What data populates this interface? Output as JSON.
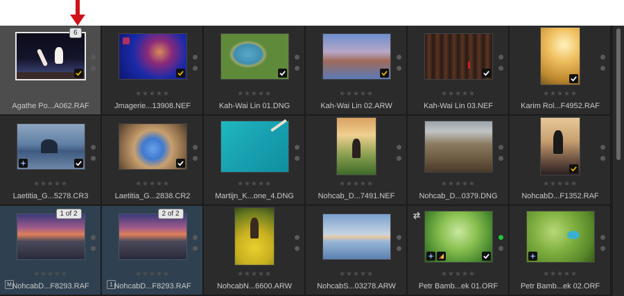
{
  "stack_counter": "6",
  "cells": [
    {
      "name": "Agathe Po...A062.RAF",
      "stars": "★★★★★",
      "check": "gold"
    },
    {
      "name": "Jmagerie...13908.NEF",
      "stars": "★★★★★",
      "check": "gold"
    },
    {
      "name": "Kah-Wai Lin 01.DNG",
      "stars": "★★★★★",
      "check": "white"
    },
    {
      "name": "Kah-Wai Lin 02.ARW",
      "stars": "★★★★★",
      "check": "gold"
    },
    {
      "name": "Kah-Wai Lin 03.NEF",
      "stars": "★★★★★",
      "check": "white"
    },
    {
      "name": "Karim Rol...F4952.RAF",
      "stars": "★★★★★",
      "check": "white"
    },
    {
      "name": "Laetitia_G...5278.CR3",
      "stars": "★★★★★",
      "check": "white"
    },
    {
      "name": "Laetitia_G...2838.CR2",
      "stars": "★★★★★",
      "check": "white"
    },
    {
      "name": "Martijn_K...one_4.DNG",
      "stars": "★★★★★"
    },
    {
      "name": "Nohcab_D...7491.NEF",
      "stars": "★★★★★"
    },
    {
      "name": "Nohcab_D...0379.DNG",
      "stars": "★★★★★"
    },
    {
      "name": "NohcabD...F1352.RAF",
      "stars": "★★★★★",
      "check": "gold"
    },
    {
      "name": "NohcabD...F8293.RAF",
      "stars": "★★★★★",
      "version": "1 of 2",
      "badge": "M"
    },
    {
      "name": "NohcabD...F8293.RAF",
      "stars": "★★★★★",
      "version": "2 of 2",
      "badge": "1"
    },
    {
      "name": "NohcabN...6600.ARW",
      "stars": "★★★★★"
    },
    {
      "name": "NohcabS...03278.ARW",
      "stars": "★★★★★"
    },
    {
      "name": "Petr Bamb...ek 01.ORF",
      "stars": "★★★★★",
      "check": "white"
    },
    {
      "name": "Petr Bamb...ek 02.ORF",
      "stars": "★★★★★"
    }
  ]
}
